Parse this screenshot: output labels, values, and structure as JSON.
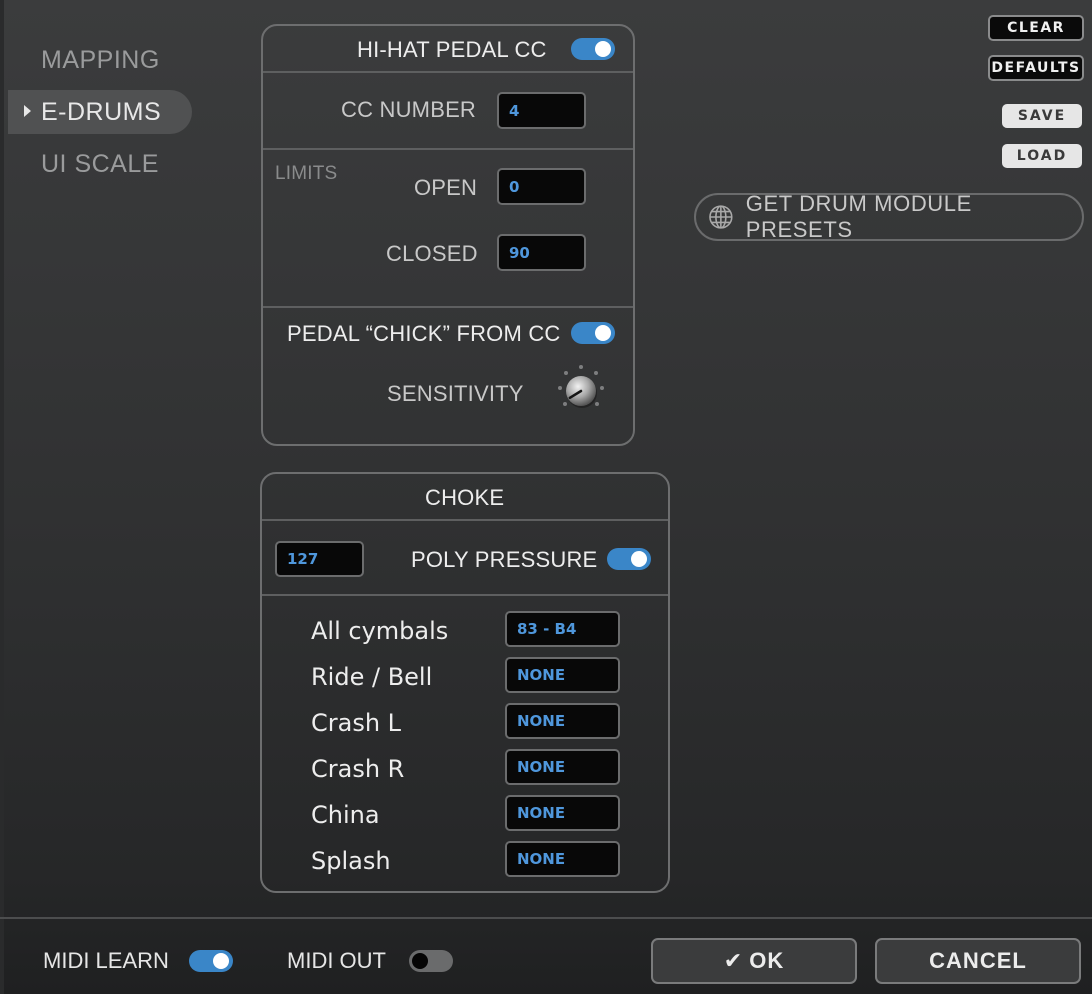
{
  "sidebar": {
    "items": [
      {
        "label": "MAPPING",
        "active": false
      },
      {
        "label": "E-DRUMS",
        "active": true
      },
      {
        "label": "UI SCALE",
        "active": false
      }
    ]
  },
  "hihat": {
    "title": "HI-HAT PEDAL CC",
    "enabled": true,
    "cc_number_label": "CC NUMBER",
    "cc_number_value": "4",
    "limits_label": "LIMITS",
    "open_label": "OPEN",
    "open_value": "0",
    "closed_label": "CLOSED",
    "closed_value": "90",
    "chick_label": "PEDAL “CHICK” FROM CC",
    "chick_enabled": true,
    "sensitivity_label": "SENSITIVITY",
    "sensitivity_value_fraction": 0.05
  },
  "choke": {
    "title": "CHOKE",
    "threshold_value": "127",
    "poly_pressure_label": "POLY PRESSURE",
    "poly_pressure_enabled": true,
    "rows": [
      {
        "label": "All  cymbals",
        "value": "83 - B4"
      },
      {
        "label": "Ride / Bell",
        "value": "NONE"
      },
      {
        "label": "Crash L",
        "value": "NONE"
      },
      {
        "label": "Crash R",
        "value": "NONE"
      },
      {
        "label": "China",
        "value": "NONE"
      },
      {
        "label": "Splash",
        "value": "NONE"
      }
    ]
  },
  "actions": {
    "clear_label": "CLEAR",
    "defaults_label": "DEFAULTS",
    "save_label": "SAVE",
    "load_label": "LOAD",
    "presets_label": "GET DRUM MODULE PRESETS",
    "presets_icon": "globe-icon"
  },
  "footer": {
    "midi_learn_label": "MIDI LEARN",
    "midi_learn_enabled": true,
    "midi_out_label": "MIDI OUT",
    "midi_out_enabled": false,
    "ok_label": "OK",
    "ok_icon": "checkmark-icon",
    "cancel_label": "CANCEL"
  },
  "colors": {
    "accent_blue": "#3a86c8",
    "value_text_blue": "#4f97dc"
  }
}
